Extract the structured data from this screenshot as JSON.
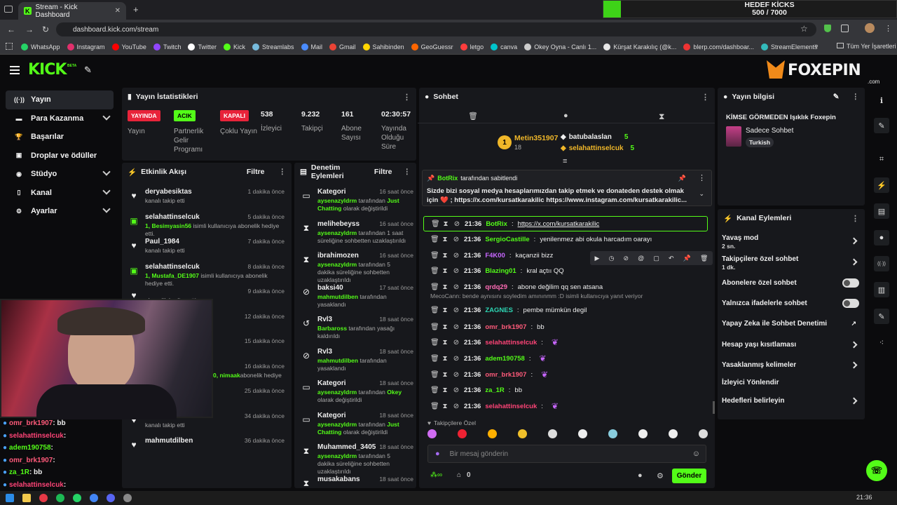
{
  "browser": {
    "tab_title": "Stream - Kick Dashboard",
    "url": "dashboard.kick.com/stream",
    "bookmarks": [
      "WhatsApp",
      "Instagram",
      "YouTube",
      "Twitch",
      "Twitter",
      "Kick",
      "Streamlabs",
      "Mail",
      "Gmail",
      "Sahibinden",
      "GeoGuessr",
      "letgo",
      "canva",
      "Okey Oyna - Canlı 1...",
      "Kürşat Karakılıç (@k...",
      "blerp.com/dashboar...",
      "StreamElements"
    ],
    "all_bookmarks": "Tüm Yer İşaretleri"
  },
  "goal": {
    "title": "HEDEF KİCKS",
    "value": "500 / 7000",
    "progress": 0.071
  },
  "brand": {
    "logo": "KICK",
    "beta": "BETA",
    "overlay_logo": "FOXEPIN",
    "overlay_sub": ".com"
  },
  "sidebar": {
    "items": [
      {
        "label": "Yayın",
        "icon": "broadcast-icon",
        "active": true
      },
      {
        "label": "Para Kazanma",
        "icon": "money-icon"
      },
      {
        "label": "Başarılar",
        "icon": "trophy-icon"
      },
      {
        "label": "Droplar ve ödüller",
        "icon": "gift-icon"
      },
      {
        "label": "Stüdyo",
        "icon": "studio-icon"
      },
      {
        "label": "Kanal",
        "icon": "channel-icon"
      },
      {
        "label": "Ayarlar",
        "icon": "gear-icon"
      }
    ]
  },
  "stats": {
    "title": "Yayın İstatistikleri",
    "items": [
      {
        "badge": "YAYINDA",
        "label": "Yayın",
        "color": "#e8233a"
      },
      {
        "badge": "ACIK",
        "label": "Partnerlik Gelir Programı",
        "color": "#53fc18"
      },
      {
        "badge": "KAPALI",
        "label": "Çoklu Yayın",
        "color": "#e8233a"
      },
      {
        "value": "538",
        "label": "İzleyici"
      },
      {
        "value": "9.232",
        "label": "Takipçi"
      },
      {
        "value": "161",
        "label": "Abone Sayısı"
      },
      {
        "value": "02:30:57",
        "label": "Yayında Olduğu Süre"
      }
    ]
  },
  "activity": {
    "title": "Etkinlik Akışı",
    "filter": "Filtre",
    "events": [
      {
        "user": "deryabesiktas",
        "time": "1 dakika önce",
        "desc": "kanalı takip etti"
      },
      {
        "user": "selahattinselcuk",
        "time": "5 dakika önce",
        "hl": "1, Besimyasin56",
        "desc": " isimli kullanıcıya abonelik hediye etti."
      },
      {
        "user": "Paul_1984",
        "time": "7 dakika önce",
        "desc": "kanalı takip etti"
      },
      {
        "user": "selahattinselcuk",
        "time": "8 dakika önce",
        "hl": "1, Mustafa_DE1907",
        "desc": " isimli kullanıcıya abonelik hediye etti."
      },
      {
        "user": "",
        "time": "9 dakika önce",
        "desc": "abonelik hediye etti."
      },
      {
        "user": "",
        "time": "12 dakika önce",
        "desc": "cıya abonelik hediye"
      },
      {
        "user": "",
        "time": "15 dakika önce",
        "desc": ""
      },
      {
        "user": "",
        "time": "16 dakika önce",
        "hl": "ksizTV, therennn06, 4K00, nimaak",
        "desc": "abonelik hediye etti."
      },
      {
        "user": "mrtfb58",
        "time": "25 dakika önce",
        "desc": "kanalı takip etti"
      },
      {
        "user": "ossuranSUCUK",
        "time": "34 dakika önce",
        "desc": "kanalı takip etti"
      },
      {
        "user": "mahmutdilben",
        "time": "36 dakika önce",
        "desc": ""
      }
    ]
  },
  "moderation": {
    "title": "Denetim Eylemleri",
    "filter": "Filtre",
    "events": [
      {
        "user": "Kategori",
        "time": "16 saat önce",
        "icon": "category-icon",
        "hl": "aysenazyldrm",
        "desc": " tarafından ",
        "hl2": "Just Chatting",
        "desc2": " olarak değiştirildi"
      },
      {
        "user": "melihebeyss",
        "time": "16 saat önce",
        "icon": "hourglass-icon",
        "hl": "aysenazyldrm",
        "desc": " tarafından 1 saat süreliğine sohbetten uzaklaştırıldı"
      },
      {
        "user": "ibrahimozen",
        "time": "16 saat önce",
        "icon": "hourglass-icon",
        "hl": "aysenazyldrm",
        "desc": " tarafından 5 dakika süreliğine sohbetten uzaklaştırıldı"
      },
      {
        "user": "baksi40",
        "time": "17 saat önce",
        "icon": "ban-icon",
        "hl": "mahmutdilben",
        "desc": " tarafından yasaklandı"
      },
      {
        "user": "Rvl3",
        "time": "18 saat önce",
        "icon": "undo-icon",
        "hl": "Barbaross",
        "desc": " tarafından yasağı kaldırıldı"
      },
      {
        "user": "Rvl3",
        "time": "18 saat önce",
        "icon": "ban-icon",
        "hl": "mahmutdilben",
        "desc": " tarafından yasaklandı"
      },
      {
        "user": "Kategori",
        "time": "18 saat önce",
        "icon": "category-icon",
        "hl": "aysenazyldrm",
        "desc": " tarafından ",
        "hl2": "Okey",
        "desc2": " olarak değiştirildi"
      },
      {
        "user": "Kategori",
        "time": "18 saat önce",
        "icon": "category-icon",
        "hl": "aysenazyldrm",
        "desc": " tarafından ",
        "hl2": "Just Chatting",
        "desc2": " olarak değiştirildi"
      },
      {
        "user": "Muhammed_3405",
        "time": "18 saat önce",
        "icon": "hourglass-icon",
        "hl": "aysenazyldrm",
        "desc": " tarafından 5 dakika süreliğine sohbetten uzaklaştırıldı"
      },
      {
        "user": "musakabans",
        "time": "18 saat önce",
        "icon": "hourglass-icon",
        "desc": ""
      }
    ]
  },
  "chat": {
    "title": "Sohbet",
    "top": [
      {
        "rank": "1",
        "user": "Metin351907",
        "count": "18"
      },
      {
        "user": "batubalaslan",
        "count": "5"
      },
      {
        "user": "selahattinselcuk",
        "count": "5"
      }
    ],
    "pinned": {
      "by": "BotRix",
      "by_suffix": " tarafından sabitlendi",
      "text": "Sizde bizi sosyal medya hesaplarımızdan takip etmek ve donateden destek olmak için ❤️ ; https://x.com/kursatkarakilic https://www.instagram.com/kursatkarakilic..."
    },
    "messages": [
      {
        "time": "21:36",
        "user": "BotRix",
        "color": "#53fc18",
        "text": "https://x.com/kursatkarakilic"
      },
      {
        "time": "21:36",
        "user": "SergioCastille",
        "color": "#53fc18",
        "text": "yenilenmez abi okula harcadım oarayı"
      },
      {
        "time": "21:36",
        "user": "F4K00",
        "color": "#c766ff",
        "text": "kaçanzii bizz"
      },
      {
        "time": "21:36",
        "user": "Blazing01",
        "color": "#53fc18",
        "text": "kral açtıı QQ"
      },
      {
        "time": "21:36",
        "user": "qrdq29",
        "color": "#ff6bb5",
        "text": "abone değilim qq sen atsana"
      },
      {
        "time": "21:36",
        "user": "ZAGNES",
        "color": "#2dd6b4",
        "text": "pembe mümkün degil",
        "reply": "MecoCann: bende aynısını soyledim amınınmm :D isimli kullanıcıya yanıt veriyor"
      },
      {
        "time": "21:36",
        "user": "omr_brk1907",
        "color": "#ff5a7a",
        "text": "bb"
      },
      {
        "time": "21:36",
        "user": "selahattinselcuk",
        "color": "#ff4477",
        "text": ""
      },
      {
        "time": "21:36",
        "user": "adem190758",
        "color": "#53fc18",
        "text": ""
      },
      {
        "time": "21:36",
        "user": "omr_brk1907",
        "color": "#ff5a7a",
        "text": ""
      },
      {
        "time": "21:36",
        "user": "za_1R",
        "color": "#53fc18",
        "text": "bb"
      },
      {
        "time": "21:36",
        "user": "selahattinselcuk",
        "color": "#ff4477",
        "text": ""
      }
    ],
    "followers_only": "Takipçilere Özel",
    "placeholder": "Bir mesaj gönderin",
    "send": "Gönder",
    "points": "0"
  },
  "stream_info": {
    "title": "Yayın bilgisi",
    "stream_title": "KİMSE GÖRMEDEN Işıklık Foxepin",
    "category": "Sadece Sohbet",
    "tag": "Turkish"
  },
  "channel_actions": {
    "title": "Kanal Eylemleri",
    "items": [
      {
        "label": "Yavaş mod",
        "sub": "2 sn.",
        "kind": "chevron"
      },
      {
        "label": "Takipçilere özel sohbet",
        "sub": "1 dk.",
        "kind": "chevron"
      },
      {
        "label": "Abonelere özel sohbet",
        "kind": "toggle"
      },
      {
        "label": "Yalnızca ifadelerle sohbet",
        "kind": "toggle"
      },
      {
        "label": "Yapay Zeka ile Sohbet Denetimi",
        "kind": "external"
      },
      {
        "label": "Hesap yaşı kısıtlaması",
        "kind": "chevron"
      },
      {
        "label": "Yasaklanmış kelimeler",
        "kind": "chevron"
      },
      {
        "label": "İzleyici Yönlendir",
        "kind": "none"
      },
      {
        "label": "Hedefleri belirleyin",
        "kind": "chevron"
      }
    ]
  },
  "overlay_chat": [
    {
      "user": "omr_brk1907",
      "text": ": bb",
      "color": "#ff5a7a"
    },
    {
      "user": "selahattinselcuk",
      "text": ":",
      "color": "#ff4477"
    },
    {
      "user": "adem190758",
      "text": ":",
      "color": "#53fc18"
    },
    {
      "user": "omr_brk1907",
      "text": ":",
      "color": "#ff5a7a"
    },
    {
      "user": "za_1R",
      "text": ": bb",
      "color": "#53fc18"
    },
    {
      "user": "selahattinselcuk",
      "text": ":",
      "color": "#ff4477"
    }
  ],
  "taskbar": {
    "time": "21:36"
  }
}
